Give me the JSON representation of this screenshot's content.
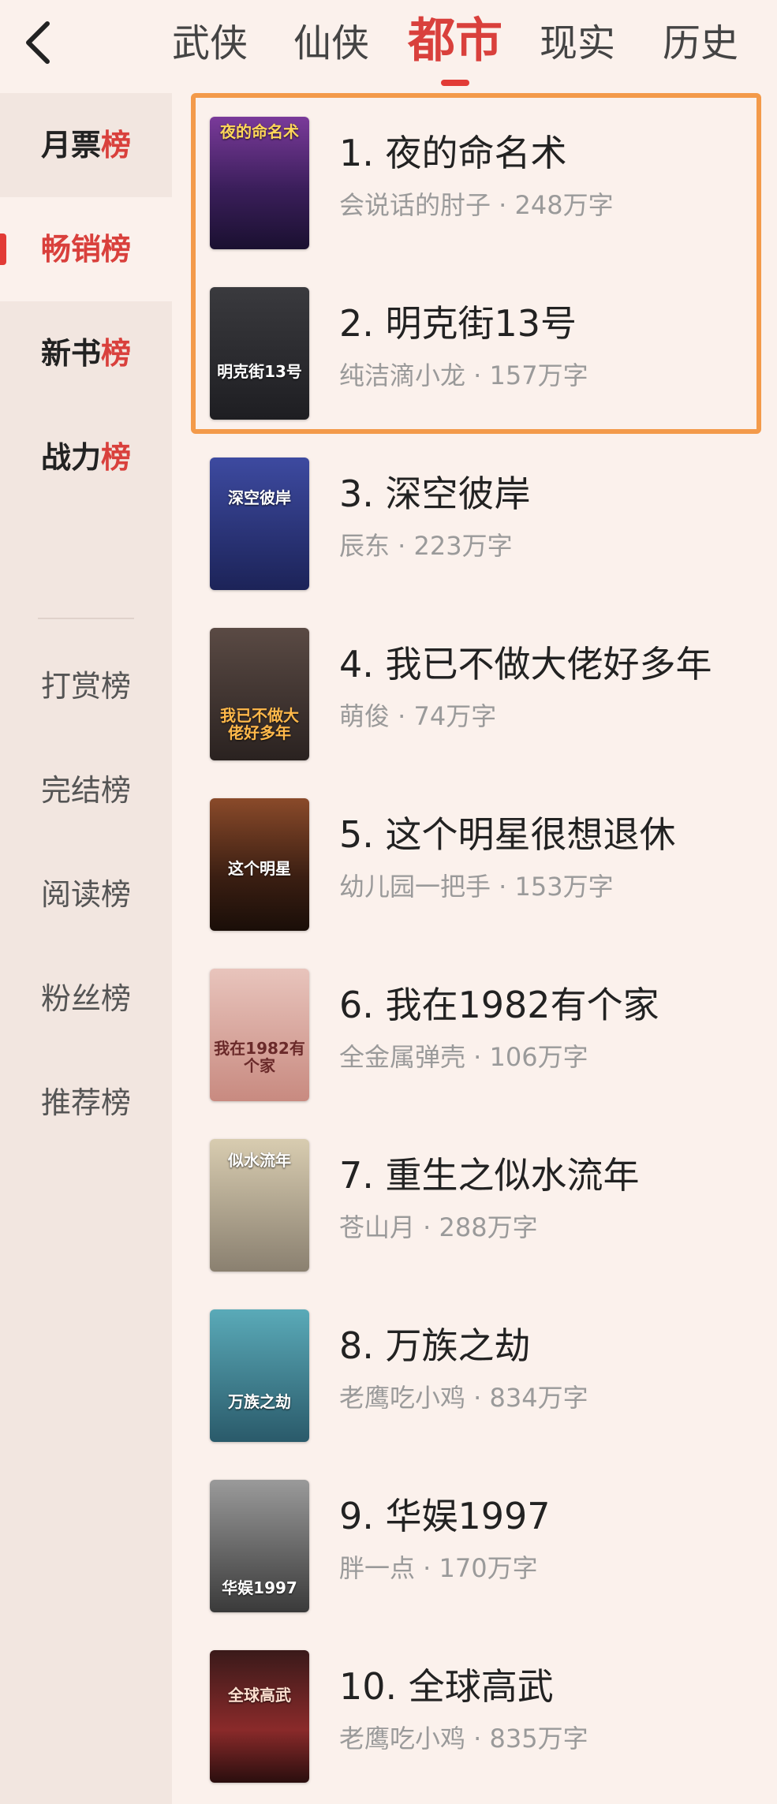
{
  "tabs": [
    "武侠",
    "仙侠",
    "都市",
    "现实",
    "历史"
  ],
  "active_tab": "都市",
  "sidebar": {
    "items": [
      {
        "label_main": "月票",
        "label_accent": "榜"
      },
      {
        "label_main": "畅销榜",
        "label_accent": ""
      },
      {
        "label_main": "新书",
        "label_accent": "榜"
      },
      {
        "label_main": "战力",
        "label_accent": "榜"
      },
      {
        "label_main": "打赏榜",
        "label_accent": ""
      },
      {
        "label_main": "完结榜",
        "label_accent": ""
      },
      {
        "label_main": "阅读榜",
        "label_accent": ""
      },
      {
        "label_main": "粉丝榜",
        "label_accent": ""
      },
      {
        "label_main": "推荐榜",
        "label_accent": ""
      }
    ],
    "selected": "畅销榜"
  },
  "books": [
    {
      "title": "1. 夜的命名术",
      "author": "会说话的肘子",
      "words": "248万字",
      "meta": "会说话的肘子 · 248万字",
      "cover_text": "夜的命名术",
      "cover_color": "#5a2f7a"
    },
    {
      "title": "2. 明克街13号",
      "author": "纯洁滴小龙",
      "words": "157万字",
      "meta": "纯洁滴小龙 · 157万字",
      "cover_text": "明克街13号",
      "cover_color": "#2a2a2e"
    },
    {
      "title": "3. 深空彼岸",
      "author": "辰东",
      "words": "223万字",
      "meta": "辰东 · 223万字",
      "cover_text": "深空彼岸",
      "cover_color": "#2b3470"
    },
    {
      "title": "4. 我已不做大佬好多年",
      "author": "萌俊",
      "words": "74万字",
      "meta": "萌俊 · 74万字",
      "cover_text": "我已不做大佬好多年",
      "cover_color": "#3a3230"
    },
    {
      "title": "5. 这个明星很想退休",
      "author": "幼儿园一把手",
      "words": "153万字",
      "meta": "幼儿园一把手 · 153万字",
      "cover_text": "这个明星",
      "cover_color": "#4a2a1e"
    },
    {
      "title": "6. 我在1982有个家",
      "author": "全金属弹壳",
      "words": "106万字",
      "meta": "全金属弹壳 · 106万字",
      "cover_text": "我在1982有个家",
      "cover_color": "#d8a49a"
    },
    {
      "title": "7. 重生之似水流年",
      "author": "苍山月",
      "words": "288万字",
      "meta": "苍山月 · 288万字",
      "cover_text": "似水流年",
      "cover_color": "#b7a88a"
    },
    {
      "title": "8. 万族之劫",
      "author": "老鹰吃小鸡",
      "words": "834万字",
      "meta": "老鹰吃小鸡 · 834万字",
      "cover_text": "万族之劫",
      "cover_color": "#3f8a9a"
    },
    {
      "title": "9. 华娱1997",
      "author": "胖一点",
      "words": "170万字",
      "meta": "胖一点 · 170万字",
      "cover_text": "华娱1997",
      "cover_color": "#5a5a5a"
    },
    {
      "title": "10. 全球高武",
      "author": "老鹰吃小鸡",
      "words": "835万字",
      "meta": "老鹰吃小鸡 · 835万字",
      "cover_text": "全球高武",
      "cover_color": "#7a2a2a"
    }
  ],
  "colors": {
    "accent": "#e23b36",
    "highlight_border": "#f39a4a",
    "background": "#fbf1ec",
    "sidebar_bg": "#f2e6e0"
  }
}
